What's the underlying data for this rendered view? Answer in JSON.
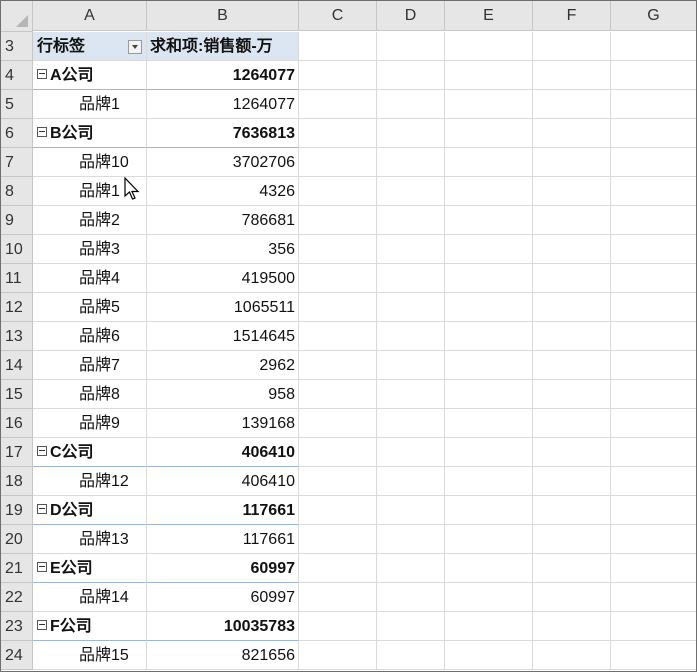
{
  "columns": [
    "A",
    "B",
    "C",
    "D",
    "E",
    "F",
    "G"
  ],
  "header": {
    "row": "3",
    "a": "行标签",
    "b": "求和项:销售额-万"
  },
  "rows": [
    {
      "row": "4",
      "label": "A公司",
      "value": "1264077",
      "group": true
    },
    {
      "row": "5",
      "label": "品牌1",
      "value": "1264077",
      "group": false
    },
    {
      "row": "6",
      "label": "B公司",
      "value": "7636813",
      "group": true
    },
    {
      "row": "7",
      "label": "品牌10",
      "value": "3702706",
      "group": false
    },
    {
      "row": "8",
      "label": "品牌1",
      "value": "4326",
      "group": false
    },
    {
      "row": "9",
      "label": "品牌2",
      "value": "786681",
      "group": false
    },
    {
      "row": "10",
      "label": "品牌3",
      "value": "356",
      "group": false
    },
    {
      "row": "11",
      "label": "品牌4",
      "value": "419500",
      "group": false
    },
    {
      "row": "12",
      "label": "品牌5",
      "value": "1065511",
      "group": false
    },
    {
      "row": "13",
      "label": "品牌6",
      "value": "1514645",
      "group": false
    },
    {
      "row": "14",
      "label": "品牌7",
      "value": "2962",
      "group": false
    },
    {
      "row": "15",
      "label": "品牌8",
      "value": "958",
      "group": false
    },
    {
      "row": "16",
      "label": "品牌9",
      "value": "139168",
      "group": false
    },
    {
      "row": "17",
      "label": "C公司",
      "value": "406410",
      "group": true
    },
    {
      "row": "18",
      "label": "品牌12",
      "value": "406410",
      "group": false
    },
    {
      "row": "19",
      "label": "D公司",
      "value": "117661",
      "group": true
    },
    {
      "row": "20",
      "label": "品牌13",
      "value": "117661",
      "group": false
    },
    {
      "row": "21",
      "label": "E公司",
      "value": "60997",
      "group": true
    },
    {
      "row": "22",
      "label": "品牌14",
      "value": "60997",
      "group": false
    },
    {
      "row": "23",
      "label": "F公司",
      "value": "10035783",
      "group": true
    },
    {
      "row": "24",
      "label": "品牌15",
      "value": "821656",
      "group": false
    }
  ],
  "icons": {
    "collapse": "collapse-minus-icon",
    "filter": "filter-dropdown-icon",
    "cursor": "mouse-pointer-icon"
  }
}
